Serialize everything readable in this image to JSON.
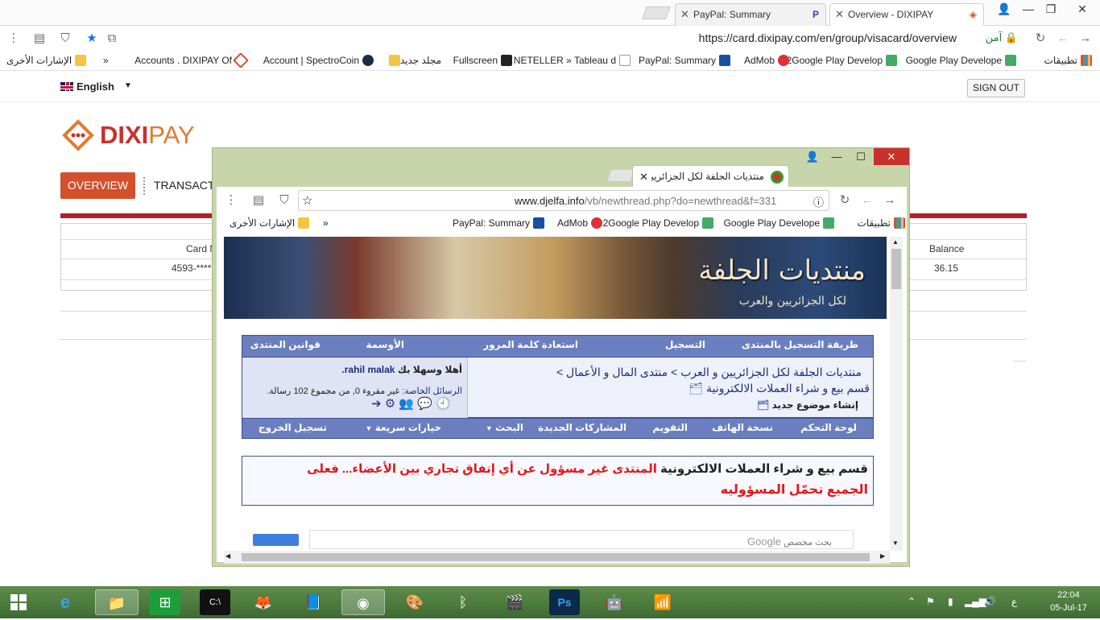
{
  "outer_browser": {
    "tabs": [
      {
        "title": "PayPal: Summary",
        "favicon": "P"
      },
      {
        "title": "Overview - DIXIPAY",
        "favicon": "◈"
      }
    ],
    "url": "https://card.dixipay.com/en/group/visacard/overview",
    "secure_label": "آمن",
    "bookmarks": [
      {
        "label": "تطبيقات"
      },
      {
        "label": "Google Play Develope"
      },
      {
        "label": "2Google Play Develop"
      },
      {
        "label": "AdMob"
      },
      {
        "label": "PayPal: Summary"
      },
      {
        "label": "NETELLER » Tableau d"
      },
      {
        "label": "Fullscreen"
      },
      {
        "label": "مجلد جديد"
      },
      {
        "label": "Account | SpectroCoin"
      },
      {
        "label": "Accounts . DIXIPAY Of"
      },
      {
        "label": "»"
      },
      {
        "label": "الإشارات الأخرى"
      }
    ]
  },
  "dixipay": {
    "language": "English",
    "sign_out": "SIGN OUT",
    "logo_a": "DIXI",
    "logo_b": "PAY",
    "nav_overview": "OVERVIEW",
    "nav_transactions": "TRANSACT",
    "table_headers": [
      "Card N",
      "Balance"
    ],
    "table_row": [
      "4593-****",
      "36.15"
    ]
  },
  "inner_browser": {
    "tab_title": "منتديات الجلفة لكل الجزائريين",
    "url_host": "www.djelfa.info",
    "url_path": "/vb/newthread.php?do=newthread&f=331",
    "bookmarks": [
      {
        "label": "تطبيقات"
      },
      {
        "label": "Google Play Develope"
      },
      {
        "label": "2Google Play Develop"
      },
      {
        "label": "AdMob"
      },
      {
        "label": "PayPal: Summary"
      },
      {
        "label": "»"
      },
      {
        "label": "الإشارات الأخرى"
      }
    ]
  },
  "forum": {
    "banner_title": "منتديات الجلفة",
    "banner_subtitle": "لكل الجزائريين والعرب",
    "top_nav": [
      "طريقة التسجيل بالمنتدى",
      "التسجيل",
      "استعادة كلمة المرور",
      "الأوسمة",
      "قوانين المنتدى"
    ],
    "breadcrumb_1": "منتديات الجلفة لكل الجزائريين و العرب > منتدى المال و الأعمال >",
    "breadcrumb_2": "قسم بيع و شراء العملات الالكترونية",
    "breadcrumb_3": "إنشاء موضوع جديد",
    "welcome": "أهلا وسهلا بك",
    "username": "rahil malak.",
    "pm_label": "الرسائل الخاصة:",
    "pm_text": "غير مقروء 0, من مجموع 102 رسالة.",
    "bottom_nav": [
      "لوحة التحكم",
      "نسخة الهاتف",
      "التقويم",
      "المشاركات الجديدة",
      "البحث",
      "خيارات سريعة",
      "تسجيل الخروج"
    ],
    "notice_section": "قسم بيع و شراء العملات الالكترونية",
    "notice_red_1": "المنتدى غير مسؤول عن أي إتفاق تجاري بين الأعضاء... فعلى",
    "notice_red_2": "الجميع تحمّل المسؤوليه",
    "search_placeholder": "بحث مخصص",
    "search_brand": "Google"
  },
  "taskbar": {
    "time": "22:04",
    "date": "05-Jul-17",
    "lang": "ع"
  }
}
